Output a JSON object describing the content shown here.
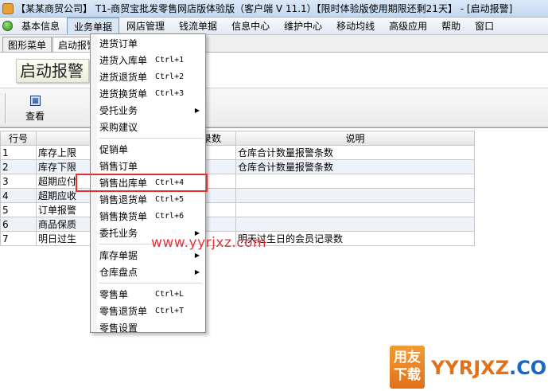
{
  "titlebar": {
    "title": "【某某商贸公司】 T1-商贸宝批发零售网店版体验版（客户端 V 11.1）【限时体验版使用期限还剩21天】 - [启动报警]"
  },
  "menubar": {
    "items": [
      "基本信息",
      "业务单据",
      "网店管理",
      "钱流单据",
      "信息中心",
      "维护中心",
      "移动均线",
      "高级应用",
      "帮助",
      "窗口"
    ]
  },
  "tabs": [
    "图形菜单",
    "启动报警"
  ],
  "page": {
    "title": "启动报警"
  },
  "toolbar": {
    "view_label": "查看"
  },
  "grid": {
    "headers": [
      "行号",
      "",
      "录数",
      "说明"
    ],
    "rows": [
      {
        "no": "1",
        "name": "库存上限",
        "count": "",
        "desc": "仓库合计数量报警条数"
      },
      {
        "no": "2",
        "name": "库存下限",
        "count": "",
        "desc": "仓库合计数量报警条数"
      },
      {
        "no": "3",
        "name": "超期应付",
        "count": "",
        "desc": ""
      },
      {
        "no": "4",
        "name": "超期应收",
        "count": "",
        "desc": ""
      },
      {
        "no": "5",
        "name": "订单报警",
        "count": "",
        "desc": ""
      },
      {
        "no": "6",
        "name": "商品保质",
        "count": "",
        "desc": ""
      },
      {
        "no": "7",
        "name": "明日过生",
        "count": "",
        "desc": "明天过生日的会员记录数"
      }
    ]
  },
  "dropdown": {
    "items": [
      {
        "label": "进货订单",
        "shortcut": ""
      },
      {
        "label": "进货入库单",
        "shortcut": "Ctrl+1"
      },
      {
        "label": "进货退货单",
        "shortcut": "Ctrl+2"
      },
      {
        "label": "进货换货单",
        "shortcut": "Ctrl+3"
      },
      {
        "label": "受托业务",
        "shortcut": ""
      },
      {
        "label": "采购建议",
        "shortcut": ""
      },
      {
        "label": "促销单",
        "shortcut": ""
      },
      {
        "label": "销售订单",
        "shortcut": ""
      },
      {
        "label": "销售出库单",
        "shortcut": "Ctrl+4"
      },
      {
        "label": "销售退货单",
        "shortcut": "Ctrl+5"
      },
      {
        "label": "销售换货单",
        "shortcut": "Ctrl+6"
      },
      {
        "label": "委托业务",
        "shortcut": ""
      },
      {
        "label": "库存单据",
        "shortcut": ""
      },
      {
        "label": "仓库盘点",
        "shortcut": ""
      },
      {
        "label": "零售单",
        "shortcut": "Ctrl+L"
      },
      {
        "label": "零售退货单",
        "shortcut": "Ctrl+T"
      },
      {
        "label": "零售设置",
        "shortcut": ""
      }
    ]
  },
  "watermark": "www.yyrjxz.com",
  "logo": {
    "box_top": "用友",
    "box_bottom": "下载",
    "text_a": "YYRJXZ",
    "text_b": ".COM"
  },
  "colors": {
    "highlight_border": "#e03030",
    "watermark": "#e8323c",
    "logo_orange": "#e2711a"
  }
}
